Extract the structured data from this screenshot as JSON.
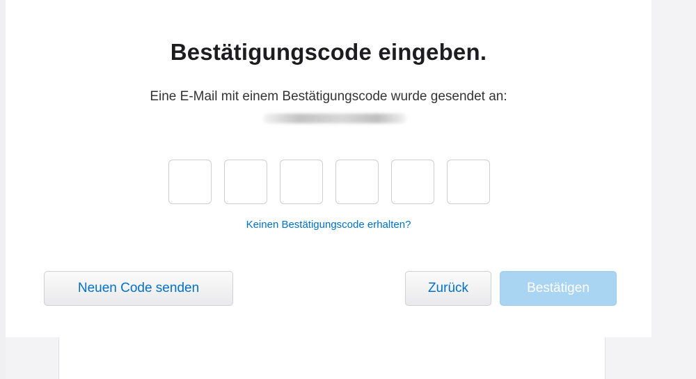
{
  "dialog": {
    "title": "Bestätigungscode eingeben.",
    "subtitle": "Eine E-Mail mit einem Bestätigungscode wurde gesendet an:",
    "code_digits": [
      "",
      "",
      "",
      "",
      "",
      ""
    ],
    "help_link": "Keinen Bestätigungscode erhalten?"
  },
  "buttons": {
    "new_code": "Neuen Code senden",
    "back": "Zurück",
    "confirm": "Bestätigen"
  },
  "colors": {
    "link": "#0070c9",
    "confirm_disabled": "#a9d4f2",
    "title": "#1d1d1f"
  }
}
